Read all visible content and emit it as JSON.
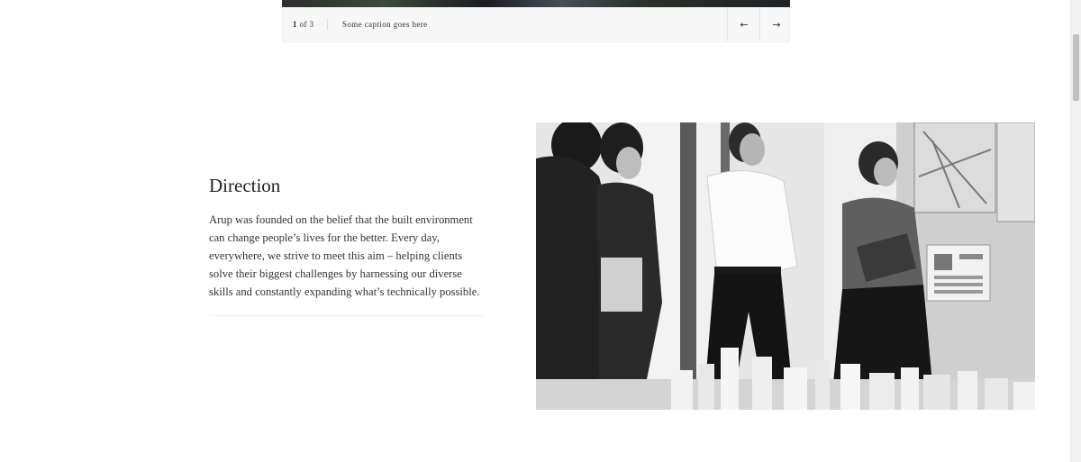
{
  "carousel": {
    "counter_current": "1",
    "counter_rest": " of 3",
    "caption": "Some caption goes here",
    "prev_icon": "arrow-left-icon",
    "next_icon": "arrow-right-icon",
    "prev_glyph": "←",
    "next_glyph": "→"
  },
  "section": {
    "title": "Direction",
    "body": "Arup was founded on the belief that the built environment can change people’s lives for the better. Every day, everywhere, we strive to meet this aim – helping clients solve their biggest challenges by harnessing our diverse skills and constantly expanding what’s technically possible."
  },
  "photo": {
    "kind": "black-and-white photo of four people looking at an architectural model and wall plans"
  }
}
